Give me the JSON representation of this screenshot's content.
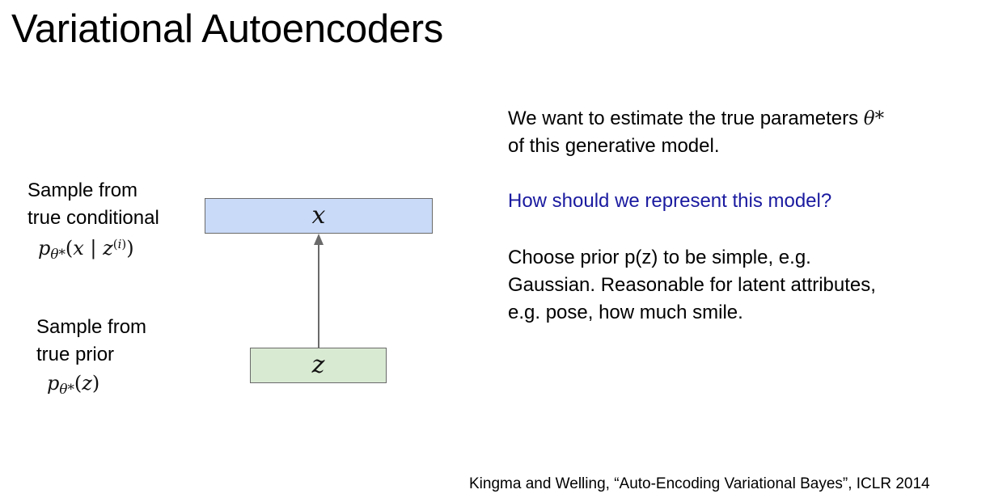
{
  "slide": {
    "title": "Variational Autoencoders",
    "left": {
      "conditional_line1": "Sample from",
      "conditional_line2": "true conditional",
      "prior_line1": "Sample from",
      "prior_line2": "true prior"
    },
    "diagram": {
      "top_box_label": "x",
      "bottom_box_label": "z",
      "top_box_color": "#c9daf8",
      "bottom_box_color": "#d9ead3"
    },
    "right": {
      "paragraph1_line1": "We want to estimate the true parameters",
      "paragraph1_line2": "of this generative model.",
      "question": "How should we represent this model?",
      "question_color": "#1a1aa0",
      "paragraph2_line1": "Choose prior p(z) to be simple, e.g.",
      "paragraph2_line2": "Gaussian. Reasonable for latent attributes,",
      "paragraph2_line3": "e.g. pose, how much smile."
    },
    "citation": "Kingma and Welling, “Auto-Encoding Variational Bayes”, ICLR 2014"
  }
}
